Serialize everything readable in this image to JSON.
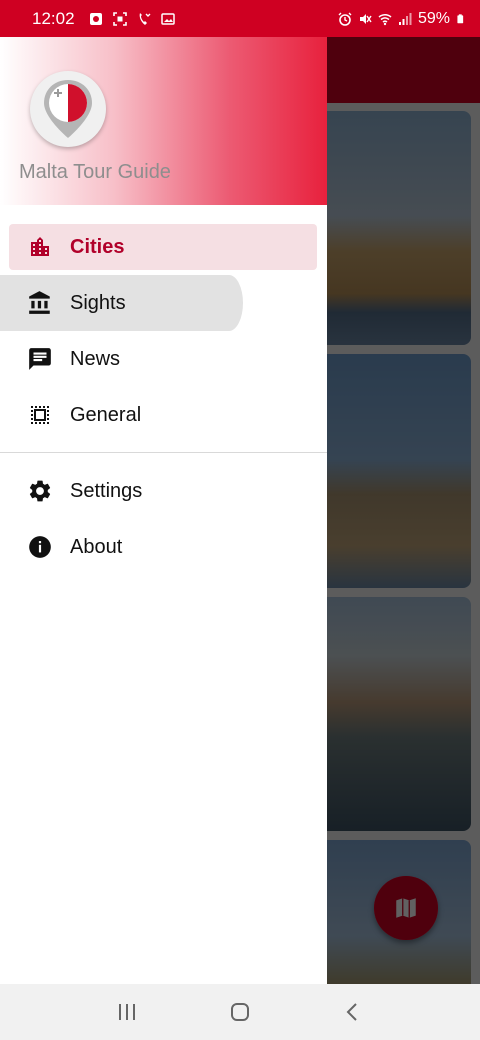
{
  "status_bar": {
    "time": "12:02",
    "battery": "59%",
    "left_icons": [
      "outlook-icon",
      "screenshot-icon",
      "missed-call-icon",
      "gallery-icon"
    ],
    "right_icons": [
      "alarm-icon",
      "mute-icon",
      "wifi-icon",
      "signal-icon",
      "battery-icon"
    ]
  },
  "drawer": {
    "app_name": "Malta Tour Guide",
    "logo_icon": "malta-flag-pin-icon",
    "items": [
      {
        "label": "Cities",
        "icon": "city-icon",
        "active": true
      },
      {
        "label": "Sights",
        "icon": "museum-icon",
        "pressed": true
      },
      {
        "label": "News",
        "icon": "news-icon"
      },
      {
        "label": "General",
        "icon": "general-icon"
      }
    ],
    "secondary_items": [
      {
        "label": "Settings",
        "icon": "gear-icon"
      },
      {
        "label": "About",
        "icon": "info-icon"
      }
    ]
  },
  "fab": {
    "icon": "map-icon"
  },
  "system_nav": {
    "buttons": [
      "recents-icon",
      "home-icon",
      "back-icon"
    ]
  },
  "colors": {
    "accent": "#cf0022",
    "active_text": "#b1002a",
    "active_bg": "#f5dfe3",
    "pressed_bg": "#e2e2e2"
  }
}
